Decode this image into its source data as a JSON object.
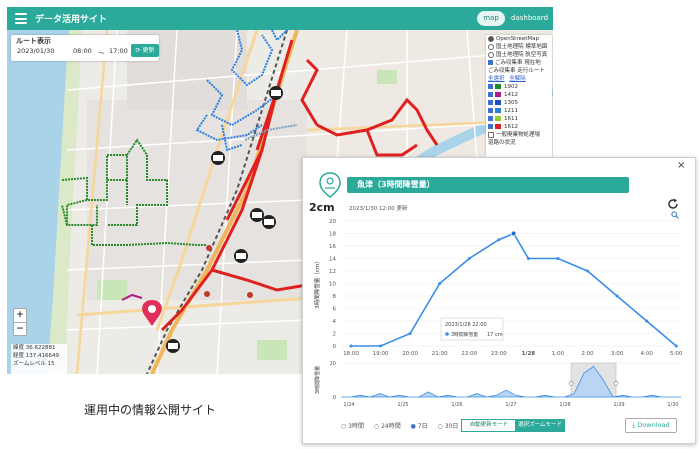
{
  "app": {
    "title": "データ活用サイト",
    "tabs": [
      "map",
      "dashboard"
    ],
    "active_tab": "map"
  },
  "route": {
    "title": "ルート表示",
    "date": "2023/01/30",
    "time_from": "08:00",
    "tilde": "〜",
    "time_to": "17:00",
    "refresh_label": "更新"
  },
  "layers": {
    "basemaps": [
      "OpenStreetMap",
      "国土地理院 標準地図",
      "国土地理院 航空写真"
    ],
    "selected_basemap": "OpenStreetMap",
    "overlays": [
      "ごみ収集車 現在地",
      "ごみ収集車 走行ルート"
    ],
    "select_all": "全選択",
    "deselect_all": "全解除",
    "vehicles": [
      {
        "id": "1902",
        "color": "#1f8c2a"
      },
      {
        "id": "1412",
        "color": "#b01a8a"
      },
      {
        "id": "1305",
        "color": "#1f4fbf"
      },
      {
        "id": "1211",
        "color": "#2d7fd8"
      },
      {
        "id": "1611",
        "color": "#9acd32"
      },
      {
        "id": "1612",
        "color": "#e02020"
      }
    ],
    "extra": [
      "一般廃棄物処理場",
      "道路の状況"
    ]
  },
  "zoom": {
    "in": "+",
    "out": "−"
  },
  "coords": {
    "lat": "緯度 36.622881",
    "lng": "経度 137.416649",
    "zoom": "ズームレベル 15"
  },
  "caption": "運用中の情報公開サイト",
  "popup": {
    "close": "×",
    "station": "魚津（3時間降雪量）",
    "value": "2cm",
    "timestamp": "2023/1/30 12:00 更新",
    "chart_modes": [
      "3時間",
      "24時間",
      "7日",
      "30日"
    ],
    "selected_mode": "7日",
    "auto_update_label": "自動更新モード",
    "zoom_mode_label": "選択ズームモード",
    "download_label": "Download"
  },
  "chart_data": {
    "type": "line",
    "ylabel": "3時間降雪量（cm）",
    "ylim": [
      0,
      20
    ],
    "yticks": [
      0,
      2,
      4,
      6,
      8,
      10,
      12,
      14,
      16,
      18,
      20
    ],
    "x": [
      "18:00",
      "19:00",
      "20:00",
      "21:00",
      "22:00",
      "23:00",
      "1/28",
      "1:00",
      "2:00",
      "3:00",
      "4:00",
      "5:00"
    ],
    "points": [
      {
        "t": "18:00",
        "v": 0
      },
      {
        "t": "19:00",
        "v": 0
      },
      {
        "t": "20:00",
        "v": 2
      },
      {
        "t": "21:00",
        "v": 10
      },
      {
        "t": "22:00",
        "v": 14
      },
      {
        "t": "23:00",
        "v": 17
      },
      {
        "t": "23:30",
        "v": 18
      },
      {
        "t": "1/28",
        "v": 14
      },
      {
        "t": "1:00",
        "v": 14
      },
      {
        "t": "2:00",
        "v": 12
      },
      {
        "t": "3:00",
        "v": 8
      },
      {
        "t": "4:00",
        "v": 4
      },
      {
        "t": "5:00",
        "v": 0
      }
    ],
    "highlight": {
      "t": "23:30",
      "v": 18
    },
    "tooltip": {
      "title": "2023/1/28 22:00",
      "series": "3時間降雪量",
      "value": "17 cm"
    },
    "overview": {
      "ylabel": "3時間降雪量",
      "yticks": [
        0,
        20
      ],
      "dates": [
        "1/24",
        "1/25",
        "1/26",
        "1/27",
        "1/28",
        "1/29",
        "1/30"
      ],
      "values": [
        0,
        0,
        1,
        0,
        2,
        0,
        1,
        0,
        0,
        3,
        0,
        1,
        0,
        0,
        2,
        0,
        1,
        4,
        1,
        0,
        0,
        1,
        0,
        0,
        2,
        14,
        18,
        10,
        0,
        1,
        0,
        0,
        1,
        0,
        0,
        0
      ]
    }
  }
}
